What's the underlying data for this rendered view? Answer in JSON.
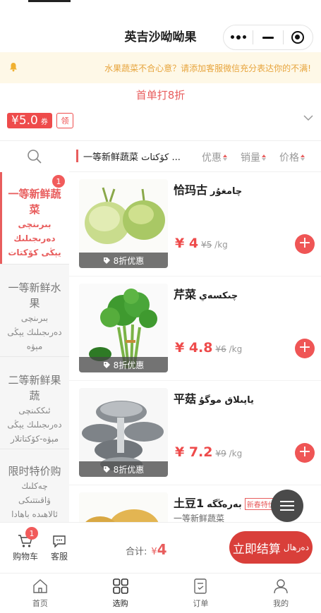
{
  "header": {
    "title": "英吉沙呦呦果"
  },
  "notice": {
    "text": "水果蔬菜不合心意？请添加客服微信充分表达你的不满!"
  },
  "promo": {
    "first_order": "首单打8折",
    "coupon_value": "¥5.0",
    "coupon_unit": "券",
    "coupon_action": "领"
  },
  "sidebar": {
    "items": [
      {
        "label": "一等新鲜蔬菜",
        "ug": "بىرىنچى دەرىجىلىك يېڭى كۆكتات",
        "badge": "1"
      },
      {
        "label": "一等新鲜水果",
        "ug": "بىرىنچى دەرىجىلىك يېڭى مېۋە"
      },
      {
        "label": "二等新鲜果蔬",
        "ug": "ئىككىنچى دەرىجىلىك يېڭى مېۋە-كۆكتاتلار"
      },
      {
        "label": "限时特价购",
        "ug": "چەكلىك ۋاقىتتىكى ئالاھىدە باھادا"
      }
    ]
  },
  "sortbar": {
    "category": "一等新鲜蔬菜 كۆكتات ...",
    "options": [
      "优惠",
      "销量",
      "价格"
    ]
  },
  "products": [
    {
      "name": "恰玛古",
      "ug": "چامغۇر",
      "price": "¥ 4",
      "old": "¥5",
      "unit": "/kg",
      "tag": "8折优惠"
    },
    {
      "name": "芹菜",
      "ug": "چىكسەي",
      "price": "¥ 4.8",
      "old": "¥6",
      "unit": "/kg",
      "tag": "8折优惠"
    },
    {
      "name": "平菇",
      "ug": "ياپىلاق موگۇ",
      "price": "¥ 7.2",
      "old": "¥9",
      "unit": "/kg",
      "tag": "8折优惠"
    },
    {
      "name": "土豆1",
      "ug": "بەرەڭگە",
      "new_tag": "新春特价",
      "sub": "一等新鲜蔬菜"
    }
  ],
  "cartbar": {
    "cart_label": "购物车",
    "cart_badge": "1",
    "service_label": "客服",
    "total_label": "合计:",
    "currency": "¥",
    "total_amount": "4",
    "checkout_label": "立即结算",
    "checkout_ug": "دەرھال"
  },
  "tabbar": [
    {
      "label": "首页",
      "icon": "home-icon"
    },
    {
      "label": "选购",
      "icon": "grid-icon"
    },
    {
      "label": "订单",
      "icon": "order-icon"
    },
    {
      "label": "我的",
      "icon": "user-icon"
    }
  ],
  "colors": {
    "accent": "#e85d5d",
    "notice_text": "#e7a43c",
    "notice_bg": "#fef8e7",
    "checkout": "#d93f3a"
  }
}
